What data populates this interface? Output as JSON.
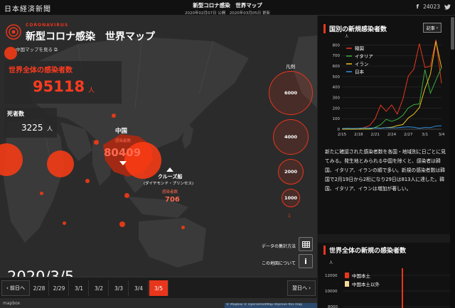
{
  "header": {
    "logo": "日本経済新聞",
    "title": "新型コロナ感染　世界マップ",
    "dates": "2020年02月07日 公開　2020年03月05日 更新",
    "share_count": "24023"
  },
  "map": {
    "corona_tag": "CORONAVIRUS",
    "title": "新型コロナ感染　世界マップ",
    "china_link": "中国マップを見る",
    "world_label": "世界全体の感染者数",
    "world_value": "95118",
    "world_unit": "人",
    "death_label": "死者数",
    "death_value": "3225",
    "death_unit": "人",
    "china_label": "中国",
    "china_sub": "感染者数",
    "china_value": "80409",
    "cruise_label": "クルーズ船",
    "cruise_sub": "(ダイヤモンド・プリンセス)",
    "cruise_cases": "感染者数",
    "cruise_value": "706",
    "legend_title": "凡例",
    "legend": [
      "6000",
      "4000",
      "2000",
      "1000",
      "1"
    ],
    "method_label": "データの集計方法",
    "about_label": "この地図について",
    "current_date": "2020/3/5",
    "prev": "前日へ",
    "next": "翌日へ",
    "dates": [
      "2/28",
      "2/29",
      "3/1",
      "3/2",
      "3/3",
      "3/4",
      "3/5"
    ],
    "mapbox": "mapbox",
    "attribution": "© Mapbox © OpenStreetMap  Improve this map"
  },
  "panel": {
    "country_title": "国別の新規感染者数",
    "article_btn": "記事",
    "description": "新たに確認された感染者数を各国・地域別に日ごとに見てみる。発生地とみられる中国を除くと、感染者は韓国、イタリア、イランの順で多い。新規の感染者数は韓国で2月19日から2桁になり29日は813人に達した。韓国、イタリア、イランは増加が著しい。",
    "world_title": "世界全体の新規の感染者数",
    "world_chart_unit": "人",
    "world_chart_yticks": [
      "12000",
      "10000",
      "8000"
    ],
    "world_legend": [
      "中国本土",
      "中国本土以外"
    ]
  },
  "chart_data": {
    "type": "line",
    "unit": "人",
    "x": [
      "2/15",
      "2/16",
      "2/17",
      "2/18",
      "2/19",
      "2/20",
      "2/21",
      "2/22",
      "2/23",
      "2/24",
      "2/25",
      "2/26",
      "2/27",
      "2/28",
      "2/29",
      "3/1",
      "3/2",
      "3/3",
      "3/4"
    ],
    "xticks": [
      "2/15",
      "2/18",
      "2/21",
      "2/24",
      "2/27",
      "3/1",
      "3/4"
    ],
    "yticks": [
      0,
      100,
      200,
      300,
      400,
      500,
      600,
      700,
      800
    ],
    "ylim": [
      0,
      850
    ],
    "legend_position": "top-left",
    "series": [
      {
        "name": "韓国",
        "color": "#e8361c",
        "values": [
          0,
          1,
          1,
          1,
          15,
          34,
          100,
          229,
          169,
          231,
          144,
          284,
          505,
          571,
          813,
          586,
          599,
          851,
          435
        ]
      },
      {
        "name": "イタリア",
        "color": "#3caa3c",
        "values": [
          0,
          0,
          0,
          0,
          0,
          0,
          17,
          42,
          93,
          74,
          93,
          131,
          202,
          233,
          240,
          566,
          342,
          466,
          587
        ]
      },
      {
        "name": "イラン",
        "color": "#e8c31c",
        "values": [
          0,
          0,
          0,
          0,
          2,
          3,
          13,
          10,
          15,
          18,
          34,
          44,
          106,
          143,
          205,
          385,
          523,
          835,
          586
        ]
      },
      {
        "name": "日本",
        "color": "#2e8fe0",
        "values": [
          6,
          8,
          7,
          8,
          12,
          11,
          12,
          9,
          14,
          13,
          14,
          18,
          22,
          18,
          9,
          16,
          14,
          29,
          33
        ]
      }
    ]
  }
}
